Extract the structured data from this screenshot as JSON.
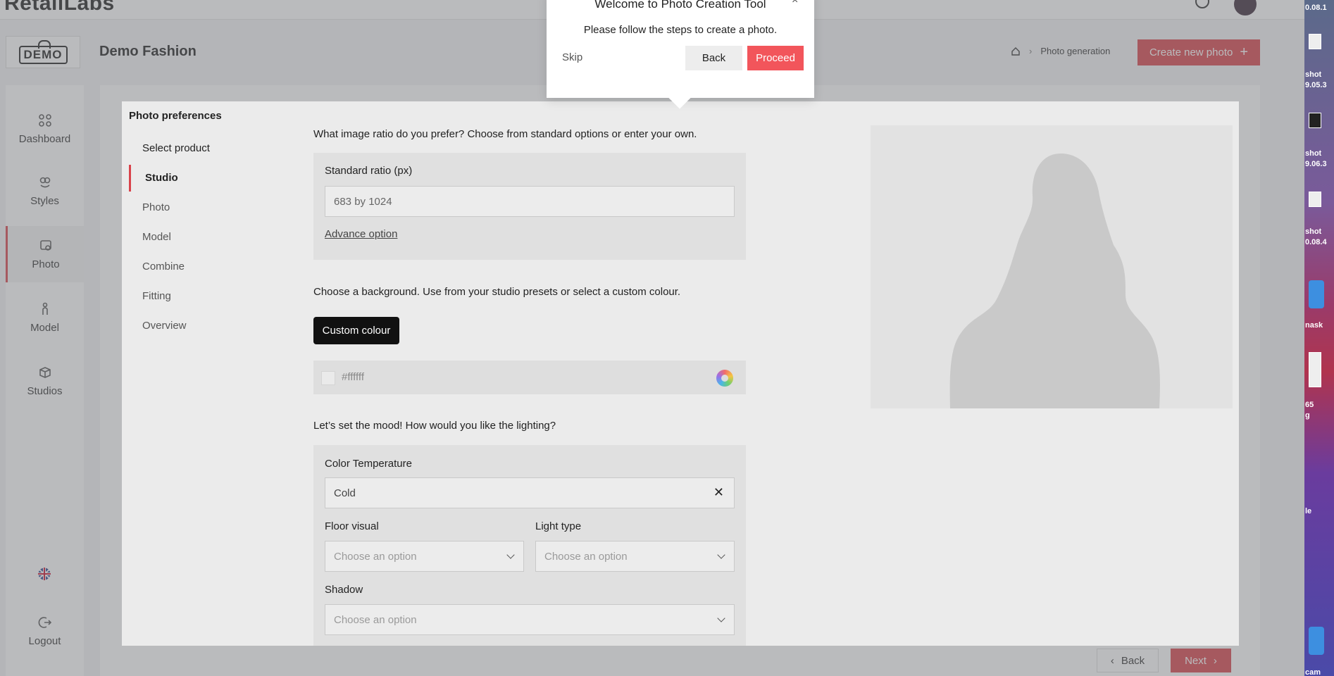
{
  "topbar": {
    "brand": "RetailLabs"
  },
  "header": {
    "logo_text": "DEMO",
    "title": "Demo Fashion",
    "breadcrumb_current": "Photo generation",
    "create_button": "Create new photo",
    "create_button_icon": "+"
  },
  "sidebar": {
    "items": [
      {
        "label": "Dashboard",
        "icon": "grid-icon"
      },
      {
        "label": "Styles",
        "icon": "palette-icon"
      },
      {
        "label": "Photo",
        "icon": "photo-icon"
      },
      {
        "label": "Model",
        "icon": "person-icon"
      },
      {
        "label": "Studios",
        "icon": "studio-icon"
      }
    ],
    "language_icon": "uk-flag-icon",
    "logout": "Logout"
  },
  "preferences": {
    "title": "Photo preferences",
    "steps": [
      "Select product",
      "Studio",
      "Photo",
      "Model",
      "Combine",
      "Fitting",
      "Overview"
    ],
    "current_step": "Studio",
    "ratio_question": "What image ratio do you prefer? Choose from standard options or enter your own.",
    "ratio_label": "Standard ratio (px)",
    "ratio_value": "683 by 1024",
    "advance_option": "Advance option",
    "background_question": "Choose a background. Use from your studio presets or select a custom colour.",
    "custom_colour_button": "Custom colour",
    "colour_value": "#ffffff",
    "lighting_question": "Let’s set the mood! How would you like the lighting?",
    "color_temp_label": "Color Temperature",
    "color_temp_value": "Cold",
    "floor_label": "Floor visual",
    "floor_placeholder": "Choose an option",
    "light_label": "Light type",
    "light_placeholder": "Choose an option",
    "shadow_label": "Shadow",
    "shadow_placeholder": "Choose an option"
  },
  "footer": {
    "back": "Back",
    "next": "Next"
  },
  "tour": {
    "title": "Welcome to Photo Creation Tool",
    "close": "×",
    "text": "Please follow the steps to create a photo.",
    "skip": "Skip",
    "back": "Back",
    "proceed": "Proceed"
  },
  "desktop": {
    "labels": [
      "0.08.1",
      "shot",
      "9.05.3",
      "shot",
      "9.06.3",
      "shot",
      "0.08.4",
      "nask",
      "65",
      "g",
      "le",
      "cam"
    ]
  },
  "colors": {
    "accent": "#d9434b",
    "proceed": "#f2555b"
  }
}
